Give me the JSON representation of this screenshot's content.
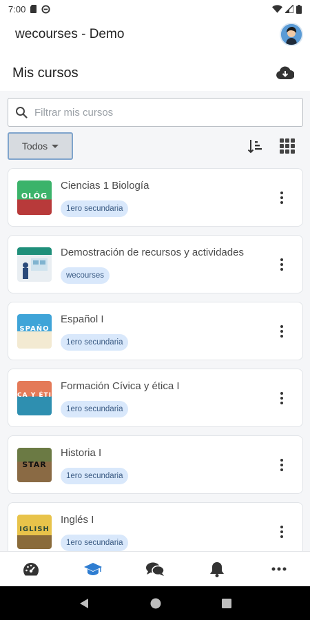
{
  "status": {
    "time": "7:00"
  },
  "header": {
    "app_title": "wecourses - Demo"
  },
  "page": {
    "title": "Mis cursos"
  },
  "search": {
    "placeholder": "Filtrar mis cursos",
    "value": ""
  },
  "filter": {
    "selected": "Todos"
  },
  "courses": [
    {
      "name": "Ciencias 1 Biología",
      "badge": "1ero secundaria",
      "thumb_text": "OLÓG",
      "thumb_color": "#2f9a5a"
    },
    {
      "name": "Demostración de recursos y actividades",
      "badge": "wecourses",
      "thumb_text": "",
      "thumb_color": "#1f8f7a"
    },
    {
      "name": "Español I",
      "badge": "1ero secundaria",
      "thumb_text": "SPAÑO",
      "thumb_color": "#3fa4d8"
    },
    {
      "name": "Formación Cívica y ética I",
      "badge": "1ero secundaria",
      "thumb_text": "CA Y ÉTI",
      "thumb_color": "#e47a58"
    },
    {
      "name": "Historia I",
      "badge": "1ero secundaria",
      "thumb_text": "STAR",
      "thumb_color": "#5a6b3a"
    },
    {
      "name": "Inglés I",
      "badge": "1ero secundaria",
      "thumb_text": "IGLISH",
      "thumb_color": "#e8c34a"
    }
  ],
  "bottom_nav": [
    {
      "icon": "dashboard-icon",
      "active": false
    },
    {
      "icon": "graduation-cap-icon",
      "active": true
    },
    {
      "icon": "chat-bubbles-icon",
      "active": false
    },
    {
      "icon": "bell-icon",
      "active": false
    },
    {
      "icon": "more-horizontal-icon",
      "active": false
    }
  ],
  "colors": {
    "accent": "#2f7dd1",
    "badge_bg": "#d9e8fb",
    "content_bg": "#f5f6f8"
  }
}
